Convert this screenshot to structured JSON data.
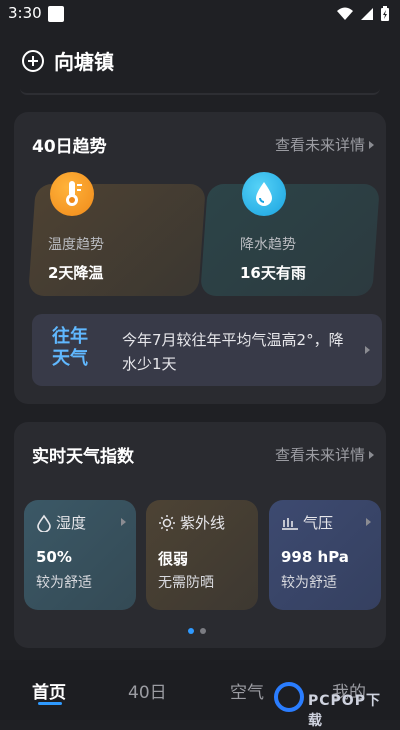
{
  "status": {
    "time": "3:30"
  },
  "header": {
    "city": "向塘镇"
  },
  "trend_card": {
    "title": "40日趋势",
    "more_label": "查看未来详情",
    "temp": {
      "label": "温度趋势",
      "value": "2天降温"
    },
    "rain": {
      "label": "降水趋势",
      "value": "16天有雨"
    },
    "history": {
      "tag_line1": "往年",
      "tag_line2": "天气",
      "text": "今年7月较往年平均气温高2°，降水少1天"
    }
  },
  "index_card": {
    "title": "实时天气指数",
    "more_label": "查看未来详情",
    "tiles": [
      {
        "label": "湿度",
        "value": "50%",
        "desc": "较为舒适"
      },
      {
        "label": "紫外线",
        "value": "很弱",
        "desc": "无需防晒"
      },
      {
        "label": "气压",
        "value": "998 hPa",
        "desc": "较为舒适"
      }
    ]
  },
  "tabs": [
    {
      "label": "首页"
    },
    {
      "label": "40日"
    },
    {
      "label": "空气"
    },
    {
      "label": "我的"
    }
  ],
  "watermark": {
    "text": "PCPOP下载"
  },
  "colors": {
    "accent": "#2f9aff",
    "background": "#1f2024",
    "card": "#2a2b30"
  }
}
